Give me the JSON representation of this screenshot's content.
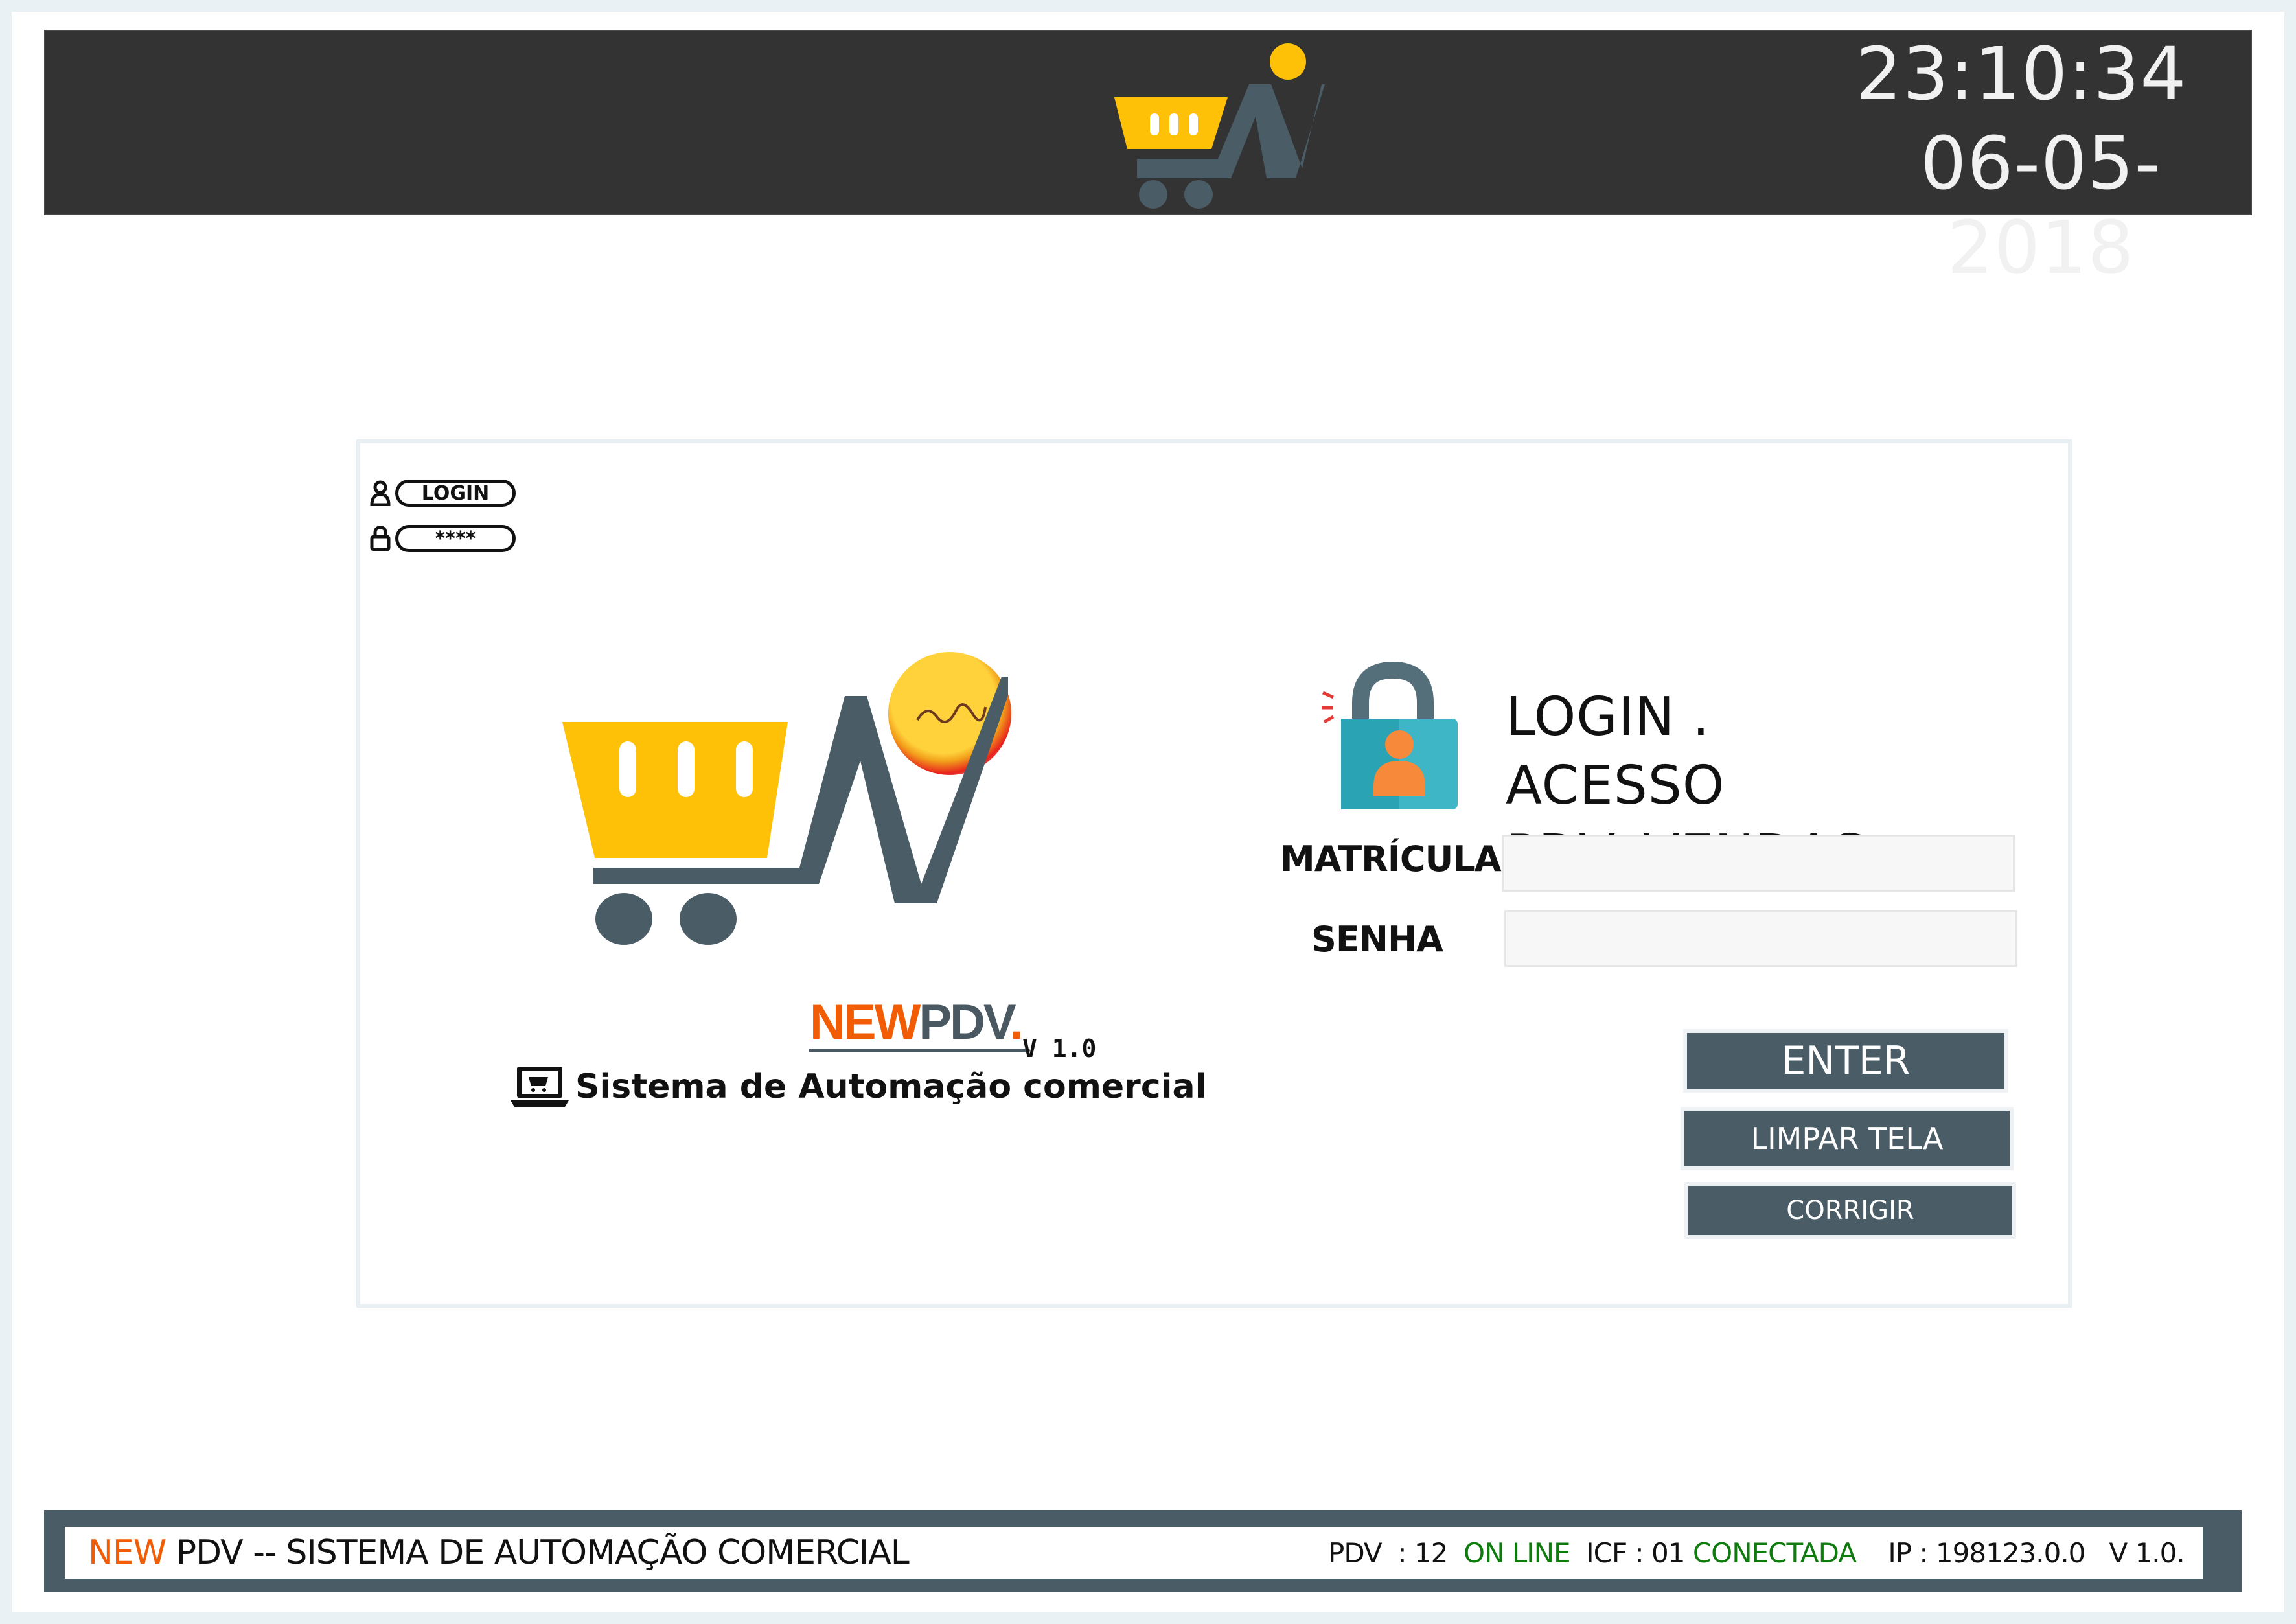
{
  "header": {
    "time": "23:10:34",
    "date": "06-05-2018",
    "logo_icon": "cart-n-logo-icon"
  },
  "login_hints": {
    "login_label": "LOGIN",
    "password_label": "****"
  },
  "brand": {
    "new_text": "NEW",
    "pdv_text": "PDV",
    "dot": ".",
    "version": "V 1.0",
    "tagline": "Sistema de Automação comercial"
  },
  "login_form": {
    "title_line1": "LOGIN .",
    "title_line2": "ACESSO PDV_VENDAS",
    "matricula_label": "MATRÍCULA",
    "matricula_value": "",
    "senha_label": "SENHA",
    "senha_value": "",
    "enter_label": "ENTER",
    "limpar_label": "LIMPAR TELA",
    "corrigir_label": "CORRIGIR"
  },
  "footer": {
    "new": "NEW",
    "title_rest": " PDV -- SISTEMA DE AUTOMAÇÃO COMERCIAL",
    "pdv": "PDV  : 12  ",
    "online": "ON LINE",
    "icf": "  ICF : 01 ",
    "conectada": "CONECTADA",
    "ip_version": "    IP : 198123.0.0   V 1.0."
  },
  "colors": {
    "header_bg": "#333333",
    "accent_orange": "#f25c05",
    "cart_yellow": "#ffc107",
    "slate": "#4a5c66",
    "status_green": "#0f7b0f"
  }
}
